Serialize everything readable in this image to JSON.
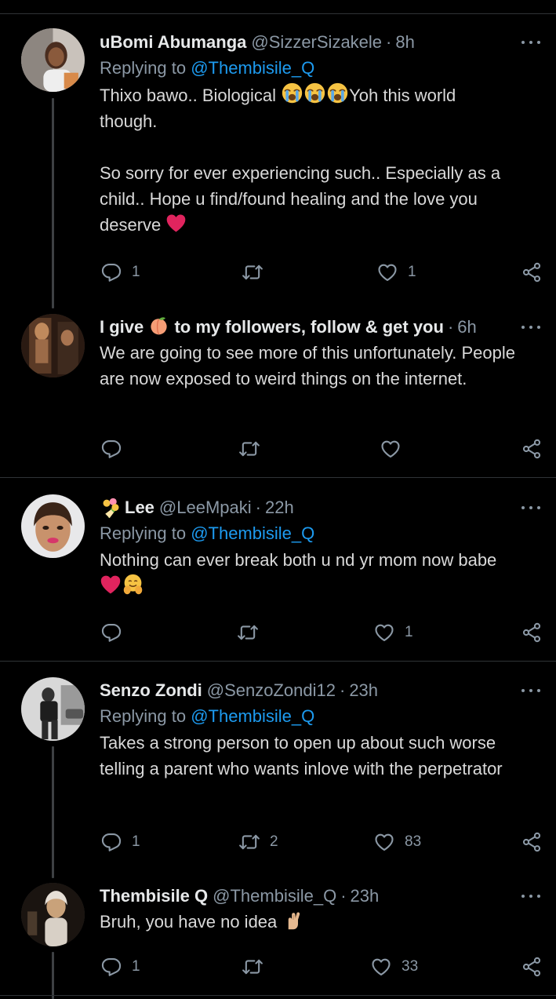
{
  "tweets": [
    {
      "name": "uBomi Abumanga",
      "handle": "@SizzerSizakele",
      "dot": "·",
      "time": "8h",
      "replying_prefix": "Replying to ",
      "replying_to": "@Thembisile_Q",
      "text_a": "Thixo bawo.. Biological ",
      "text_b": "Yoh this world\nthough.\n\nSo sorry for ever experiencing such.. Especially as a child.. Hope u find/found healing and the love you deserve ",
      "reply_count": "1",
      "retweet_count": "",
      "like_count": "1",
      "emojis": [
        "crying-face",
        "crying-face",
        "crying-face",
        "red-heart"
      ]
    },
    {
      "name_a": "I give ",
      "name_b": " to my followers, follow & get you",
      "dot": "·",
      "time": "6h",
      "text": "We are going to see more of this unfortunately. People are now exposed to weird things on the internet.",
      "reply_count": "",
      "retweet_count": "",
      "like_count": "",
      "emojis": [
        "peach"
      ]
    },
    {
      "name": "Lee",
      "handle": "@LeeMpaki",
      "dot": "·",
      "time": "22h",
      "replying_prefix": "Replying to ",
      "replying_to": "@Thembisile_Q",
      "text": "Nothing can ever break both u nd yr mom now babe",
      "reply_count": "",
      "retweet_count": "",
      "like_count": "1",
      "emojis": [
        "bouquet",
        "red-heart",
        "hugging-face"
      ]
    },
    {
      "name": "Senzo Zondi",
      "handle": "@SenzoZondi12",
      "dot": "·",
      "time": "23h",
      "replying_prefix": "Replying to ",
      "replying_to": "@Thembisile_Q",
      "text": "Takes a strong person to open up about such worse telling a parent who wants inlove with the perpetrator",
      "reply_count": "1",
      "retweet_count": "2",
      "like_count": "83",
      "emojis": []
    },
    {
      "name": "Thembisile Q",
      "handle": "@Thembisile_Q",
      "dot": "·",
      "time": "23h",
      "text": "Bruh, you have no idea ",
      "reply_count": "1",
      "retweet_count": "",
      "like_count": "33",
      "emojis": [
        "crossed-fingers"
      ]
    }
  ],
  "colors": {
    "background": "#000000",
    "text": "#d9d9d9",
    "name": "#e7e9ea",
    "muted": "#8b98a5",
    "link": "#1d9bf0",
    "divider": "#2f3336",
    "heart": "#e0245e"
  }
}
